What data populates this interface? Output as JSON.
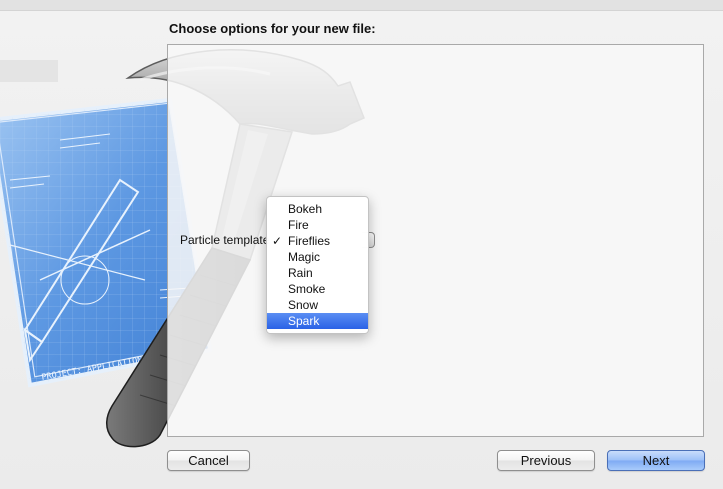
{
  "dialog": {
    "title": "Choose options for your new file:"
  },
  "options": {
    "particle_template_label": "Particle template",
    "menu": {
      "items": [
        {
          "label": "Bokeh",
          "checked": false,
          "highlighted": false
        },
        {
          "label": "Fire",
          "checked": false,
          "highlighted": false
        },
        {
          "label": "Fireflies",
          "checked": true,
          "highlighted": false
        },
        {
          "label": "Magic",
          "checked": false,
          "highlighted": false
        },
        {
          "label": "Rain",
          "checked": false,
          "highlighted": false
        },
        {
          "label": "Smoke",
          "checked": false,
          "highlighted": false
        },
        {
          "label": "Snow",
          "checked": false,
          "highlighted": false
        },
        {
          "label": "Spark",
          "checked": false,
          "highlighted": true
        }
      ],
      "check_glyph": "✓"
    }
  },
  "buttons": {
    "cancel": "Cancel",
    "previous": "Previous",
    "next": "Next"
  },
  "artwork": {
    "blueprint_label": "PROJECT: APPLICATION.APP",
    "icon": "xcode-hammer-blueprint-icon"
  },
  "colors": {
    "menu_highlight": "#2a62e6",
    "blueprint": "#4d8fe0",
    "default_button": "#8fb7f6"
  }
}
